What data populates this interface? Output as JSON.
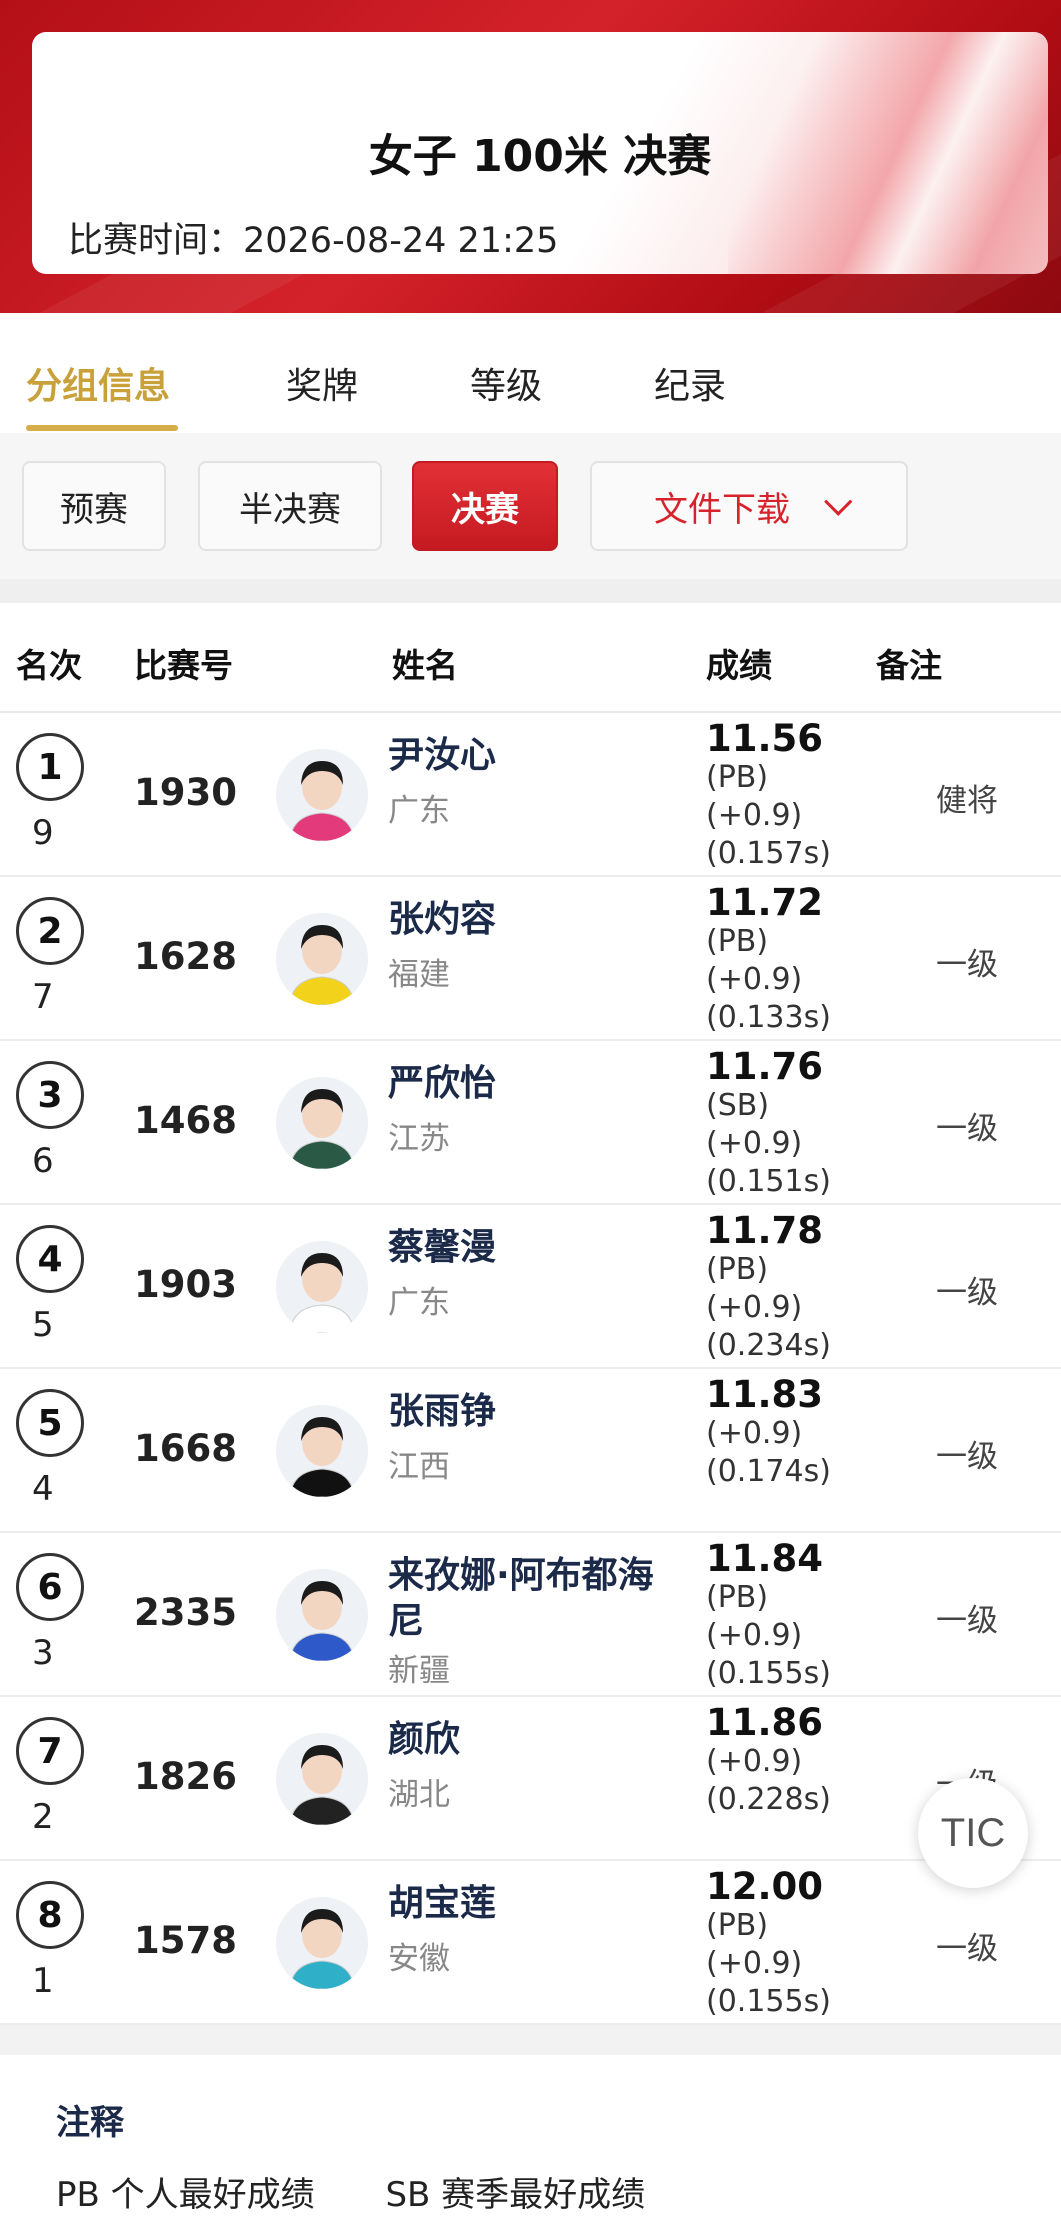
{
  "header": {
    "event_title": "女子 100米 决赛",
    "event_time": "比赛时间：2026-08-24   21:25"
  },
  "tabs": [
    {
      "label": "分组信息",
      "active": true
    },
    {
      "label": "奖牌",
      "active": false
    },
    {
      "label": "等级",
      "active": false
    },
    {
      "label": "纪录",
      "active": false
    }
  ],
  "filters": {
    "prelim": "预赛",
    "semi": "半决赛",
    "final": "决赛",
    "download": "文件下载"
  },
  "table": {
    "headers": {
      "rank": "名次",
      "bib": "比赛号",
      "name": "姓名",
      "result": "成绩",
      "remark": "备注"
    },
    "rows": [
      {
        "rank": "1",
        "lane": "9",
        "bib": "1930",
        "name": "尹汝心",
        "province": "广东",
        "time": "11.56",
        "tag": "(PB)",
        "wind": "(+0.9)",
        "reaction": "(0.157s)",
        "remark": "健将"
      },
      {
        "rank": "2",
        "lane": "7",
        "bib": "1628",
        "name": "张灼容",
        "province": "福建",
        "time": "11.72",
        "tag": "(PB)",
        "wind": "(+0.9)",
        "reaction": "(0.133s)",
        "remark": "一级"
      },
      {
        "rank": "3",
        "lane": "6",
        "bib": "1468",
        "name": "严欣怡",
        "province": "江苏",
        "time": "11.76",
        "tag": "(SB)",
        "wind": "(+0.9)",
        "reaction": "(0.151s)",
        "remark": "一级"
      },
      {
        "rank": "4",
        "lane": "5",
        "bib": "1903",
        "name": "蔡馨漫",
        "province": "广东",
        "time": "11.78",
        "tag": "(PB)",
        "wind": "(+0.9)",
        "reaction": "(0.234s)",
        "remark": "一级"
      },
      {
        "rank": "5",
        "lane": "4",
        "bib": "1668",
        "name": "张雨铮",
        "province": "江西",
        "time": "11.83",
        "tag": "",
        "wind": "(+0.9)",
        "reaction": "(0.174s)",
        "remark": "一级"
      },
      {
        "rank": "6",
        "lane": "3",
        "bib": "2335",
        "name": "来孜娜·阿布都海尼",
        "province": "新疆",
        "time": "11.84",
        "tag": "(PB)",
        "wind": "(+0.9)",
        "reaction": "(0.155s)",
        "remark": "一级"
      },
      {
        "rank": "7",
        "lane": "2",
        "bib": "1826",
        "name": "颜欣",
        "province": "湖北",
        "time": "11.86",
        "tag": "",
        "wind": "(+0.9)",
        "reaction": "(0.228s)",
        "remark": "一级"
      },
      {
        "rank": "8",
        "lane": "1",
        "bib": "1578",
        "name": "胡宝莲",
        "province": "安徽",
        "time": "12.00",
        "tag": "(PB)",
        "wind": "(+0.9)",
        "reaction": "(0.155s)",
        "remark": "一级"
      }
    ]
  },
  "notes": {
    "title": "注释",
    "pb": "PB 个人最好成绩",
    "sb": "SB 赛季最好成绩"
  },
  "fab": {
    "label": "TIC"
  },
  "colors": {
    "brand_red": "#d7232b",
    "gold_accent": "#c9a13a",
    "name_navy": "#1c2a4a"
  }
}
